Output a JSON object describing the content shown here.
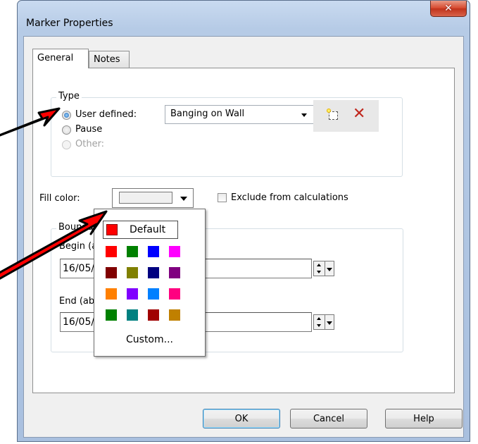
{
  "window": {
    "title": "Marker Properties",
    "close_glyph": "✕"
  },
  "tabs": [
    {
      "label": "General"
    },
    {
      "label": "Notes"
    }
  ],
  "type_group": {
    "legend": "Type",
    "options": [
      {
        "label": "User defined:",
        "checked": true,
        "enabled": true
      },
      {
        "label": "Pause",
        "checked": false,
        "enabled": true
      },
      {
        "label": "Other:",
        "checked": false,
        "enabled": false
      }
    ],
    "user_defined_value": "Banging on Wall",
    "new_icon": "new-marker-icon",
    "delete_icon": "delete-icon",
    "delete_glyph": "✕"
  },
  "fill_color": {
    "label": "Fill color:"
  },
  "exclude": {
    "label": "Exclude from calculations",
    "checked": false
  },
  "boundaries": {
    "legend": "Boundaries",
    "begin_label": "Begin (absolute)",
    "begin_value": "16/05/20",
    "end_label": "End (absolute)",
    "end_value": "16/05/20"
  },
  "color_popup": {
    "default_label": "Default",
    "default_color": "#ff0000",
    "colors": [
      [
        "#ff0000",
        "#008000",
        "#0000ff",
        "#ff00ff"
      ],
      [
        "#800000",
        "#808000",
        "#000080",
        "#800080"
      ],
      [
        "#ff8000",
        "#8000ff",
        "#0080ff",
        "#ff0080"
      ],
      [
        "#008000",
        "#008080",
        "#a00000",
        "#c08000"
      ]
    ],
    "custom_label": "Custom..."
  },
  "buttons": {
    "ok": "OK",
    "cancel": "Cancel",
    "help": "Help"
  },
  "annotation_color": "#ff0000"
}
